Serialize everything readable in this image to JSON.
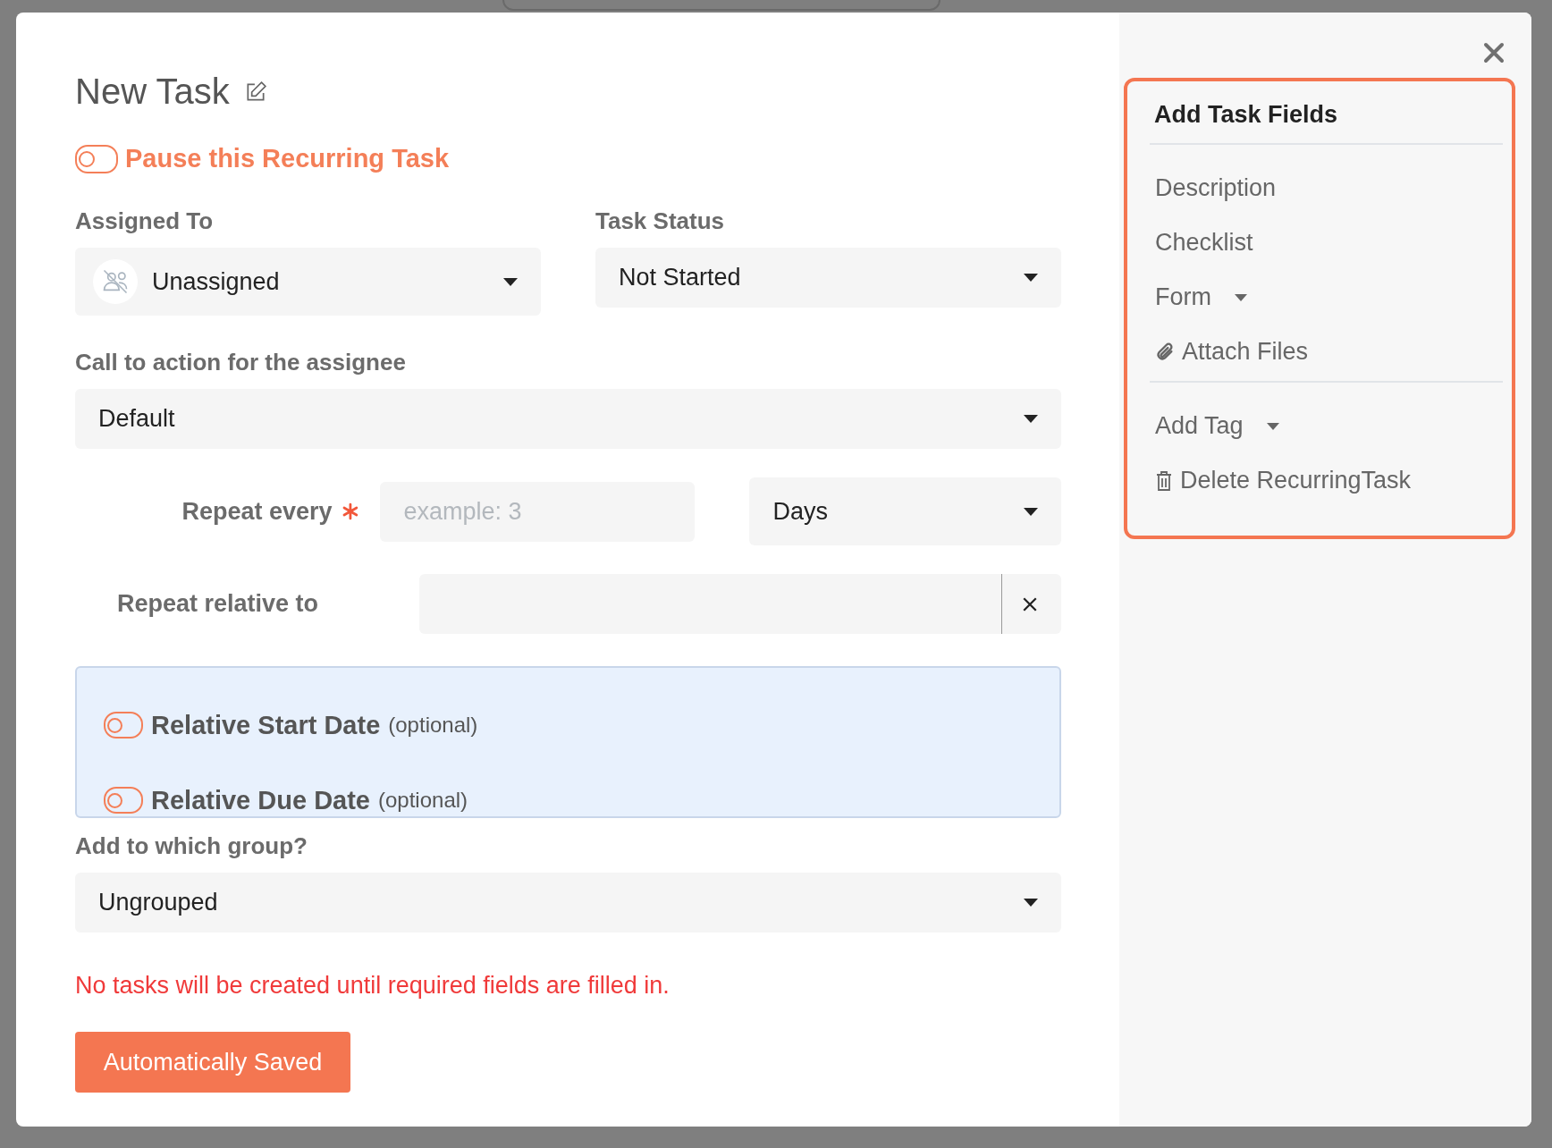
{
  "dialog": {
    "title": "New Task",
    "pause": {
      "label": "Pause this Recurring Task",
      "on": false
    },
    "assigned": {
      "label": "Assigned To",
      "value": "Unassigned"
    },
    "status": {
      "label": "Task Status",
      "value": "Not Started"
    },
    "cta": {
      "label": "Call to action for the assignee",
      "value": "Default"
    },
    "repeat_every": {
      "label": "Repeat every",
      "required": true,
      "placeholder": "example: 3",
      "unit": "Days"
    },
    "repeat_relative": {
      "label": "Repeat relative to"
    },
    "relative_dates": [
      {
        "label": "Relative Start Date",
        "note": "(optional)",
        "on": false
      },
      {
        "label": "Relative Due Date",
        "note": "(optional)",
        "on": false
      }
    ],
    "group": {
      "label": "Add to which group?",
      "value": "Ungrouped"
    },
    "error": "No tasks will be created until required fields are filled in.",
    "save_button": "Automatically Saved"
  },
  "sidebar": {
    "title": "Add Task Fields",
    "sections": [
      {
        "items": [
          {
            "label": "Description",
            "kind": "plain"
          },
          {
            "label": "Checklist",
            "kind": "plain"
          },
          {
            "label": "Form",
            "kind": "dropdown"
          },
          {
            "label": "Attach Files",
            "kind": "attach"
          }
        ]
      },
      {
        "items": [
          {
            "label": "Add Tag",
            "kind": "dropdown"
          },
          {
            "label": "Delete RecurringTask",
            "kind": "delete"
          }
        ]
      }
    ]
  }
}
